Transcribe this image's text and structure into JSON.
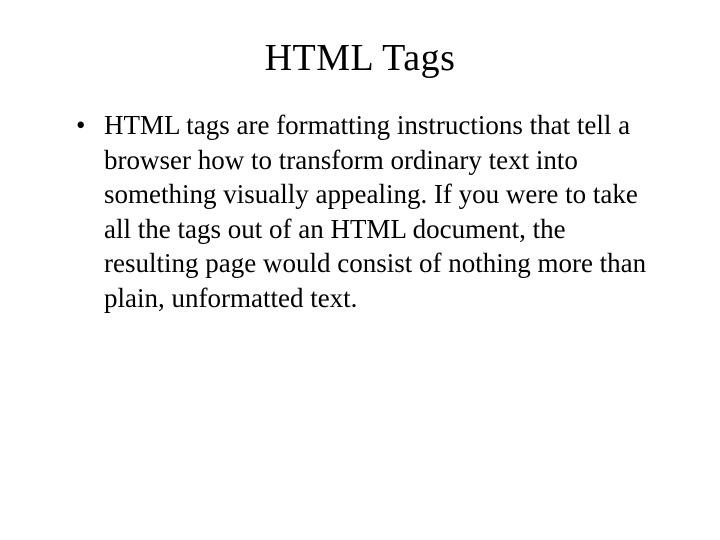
{
  "slide": {
    "title": "HTML Tags",
    "bullets": [
      "HTML tags are formatting instructions that tell a browser how to transform ordinary text into something visually appealing. If you were to take all the tags out of an HTML document, the resulting page would consist of nothing more than plain, unformatted text."
    ]
  }
}
